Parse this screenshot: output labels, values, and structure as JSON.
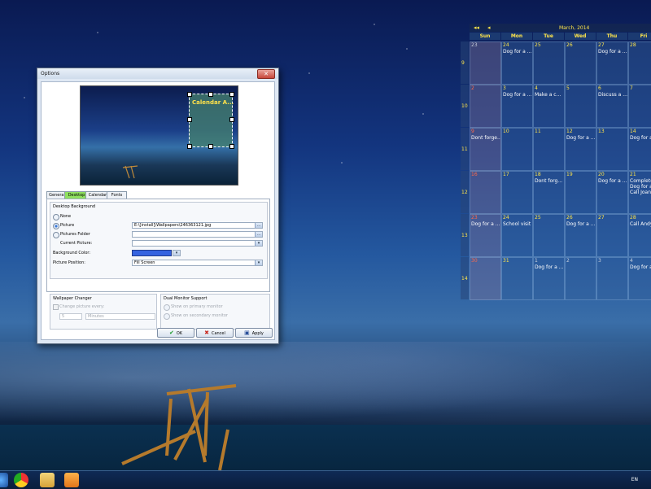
{
  "window": {
    "title": "Options",
    "close_glyph": "✕",
    "preview_widget_label": "Calendar A...",
    "tabs": [
      "General",
      "Desktop",
      "Calendar",
      "Fonts"
    ],
    "desktop_background": {
      "group_title": "Desktop Background",
      "none_label": "None",
      "picture_label": "Picture",
      "picture_value": "E:\\[install]\\Wallpapers\\246363121.jpg",
      "folder_label": "Pictures Folder",
      "folder_value": "",
      "current_picture_label": "Current Picture:",
      "current_picture_value": "",
      "bg_color_label": "Background Color:",
      "bg_color": "#3563e0",
      "position_label": "Picture Position:",
      "position_value": "Fill Screen",
      "selected": "picture"
    },
    "wallpaper_changer": {
      "group_title": "Wallpaper Changer",
      "change_label": "Change picture every:",
      "interval_value": "5",
      "unit_value": "Minutes"
    },
    "dual_monitor": {
      "group_title": "Dual Monitor Support",
      "primary_label": "Show on primary monitor",
      "secondary_label": "Show on secondary monitor"
    },
    "buttons": {
      "ok": "OK",
      "cancel": "Cancel",
      "apply": "Apply"
    },
    "browse_glyph": "...",
    "dropdown_glyph": "▾"
  },
  "calendar": {
    "month_label": "March, 2014",
    "nav_prev_year": "◂◂",
    "nav_prev": "◂",
    "day_names": [
      "Sun",
      "Mon",
      "Tue",
      "Wed",
      "Thu",
      "Fri"
    ],
    "weeks": [
      {
        "num": "9",
        "days": [
          {
            "d": "23",
            "e": "",
            "t": "grey"
          },
          {
            "d": "24",
            "e": "Dog for a ..."
          },
          {
            "d": "25",
            "e": ""
          },
          {
            "d": "26",
            "e": ""
          },
          {
            "d": "27",
            "e": "Dog for a ..."
          },
          {
            "d": "28",
            "e": ""
          }
        ]
      },
      {
        "num": "10",
        "days": [
          {
            "d": "2",
            "e": "",
            "t": "red"
          },
          {
            "d": "3",
            "e": "Dog for a ..."
          },
          {
            "d": "4",
            "e": "Make a c..."
          },
          {
            "d": "5",
            "e": ""
          },
          {
            "d": "6",
            "e": "Discuss a ..."
          },
          {
            "d": "7",
            "e": ""
          }
        ]
      },
      {
        "num": "11",
        "days": [
          {
            "d": "9",
            "e": "Dont forge...",
            "t": "red"
          },
          {
            "d": "10",
            "e": ""
          },
          {
            "d": "11",
            "e": ""
          },
          {
            "d": "12",
            "e": "Dog for a ..."
          },
          {
            "d": "13",
            "e": ""
          },
          {
            "d": "14",
            "e": "Dog for a ..."
          }
        ]
      },
      {
        "num": "12",
        "days": [
          {
            "d": "16",
            "e": "",
            "t": "red"
          },
          {
            "d": "17",
            "e": ""
          },
          {
            "d": "18",
            "e": "Dont forg..."
          },
          {
            "d": "19",
            "e": ""
          },
          {
            "d": "20",
            "e": "Dog for a ..."
          },
          {
            "d": "21",
            "e": "Complete\nDog for a\nCall Joan"
          }
        ]
      },
      {
        "num": "13",
        "days": [
          {
            "d": "23",
            "e": "Dog for a ...",
            "t": "red"
          },
          {
            "d": "24",
            "e": "School visit"
          },
          {
            "d": "25",
            "e": ""
          },
          {
            "d": "26",
            "e": "Dog for a ..."
          },
          {
            "d": "27",
            "e": ""
          },
          {
            "d": "28",
            "e": "Call Andy"
          }
        ]
      },
      {
        "num": "14",
        "days": [
          {
            "d": "30",
            "e": "",
            "t": "red"
          },
          {
            "d": "31",
            "e": ""
          },
          {
            "d": "1",
            "e": "Dog for a ...",
            "t": "grey"
          },
          {
            "d": "2",
            "e": "",
            "t": "grey"
          },
          {
            "d": "3",
            "e": "",
            "t": "grey"
          },
          {
            "d": "4",
            "e": "Dog for a",
            "t": "grey"
          }
        ]
      }
    ]
  },
  "taskbar": {
    "tray_language": "EN",
    "icons": [
      "start-orb-icon",
      "chrome-icon",
      "file-explorer-icon",
      "media-player-icon"
    ]
  },
  "colors": {
    "accent_tab": "#8fe060",
    "calendar_text": "#ffe54a",
    "sunday_red": "#ff6a4a"
  }
}
